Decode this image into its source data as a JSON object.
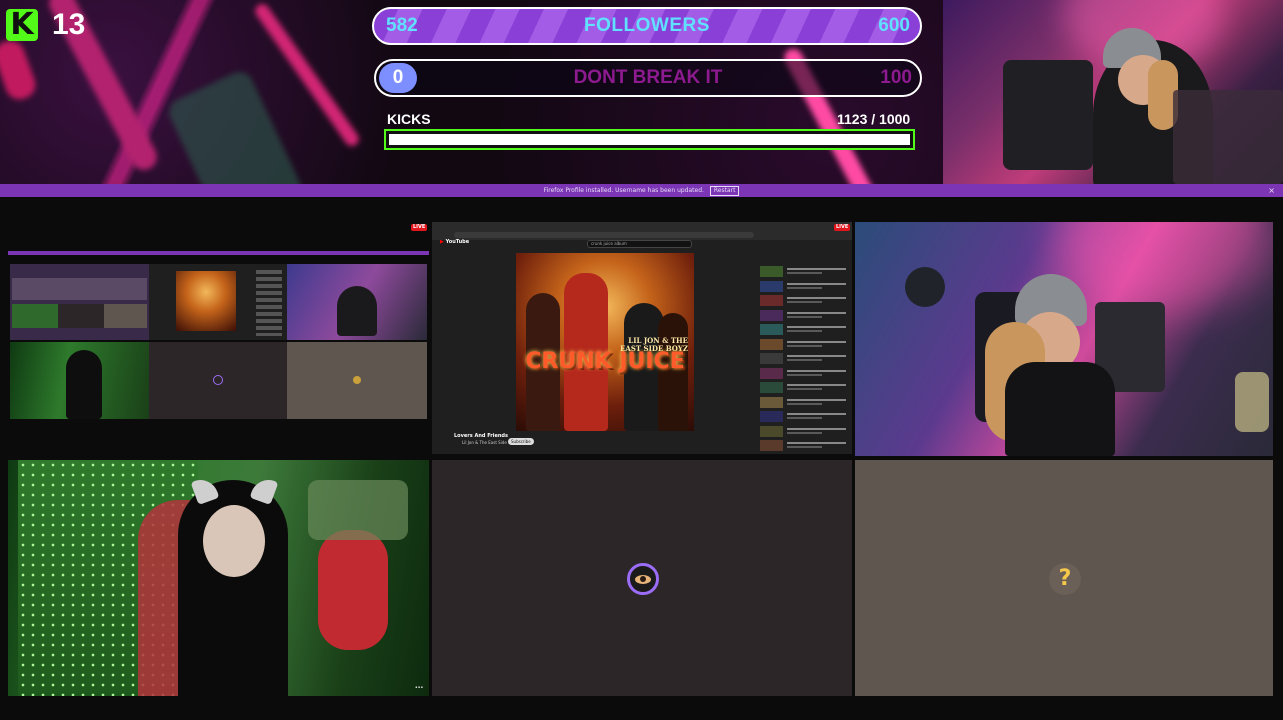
{
  "overlay": {
    "viewer_count": "13",
    "logo_letter": "K",
    "followers": {
      "current": "582",
      "label": "FOLLOWERS",
      "goal": "600"
    },
    "dont_break": {
      "current": "0",
      "label": "DONT BREAK IT",
      "goal": "100"
    },
    "kicks": {
      "label": "KICKS",
      "count": "1123 / 1000",
      "progress": 1.0
    }
  },
  "notification": {
    "text": "Firefox Profile installed. Username has been updated.",
    "button_label": "Restart",
    "close_label": "×"
  },
  "grid": {
    "live_badge": "LIVE",
    "youtube": {
      "logo": "YouTube",
      "search_text": "crunk juice album",
      "album_artist": "LIL JON & THE EAST SIDE BOYZ",
      "album_title": "CRUNK JUICE",
      "video_title": "Lovers And Friends",
      "channel": "Lil Jon & The East Side Boyz",
      "subscribe": "Subscribe",
      "sidebar_count": 14
    },
    "more_label": "⋯"
  },
  "colors": {
    "kick_green": "#53fc18",
    "follower_bar": "#8a3fd6",
    "follower_text": "#5fe1ff",
    "goal_text": "#8d1a8f",
    "notify_bar": "#7b35b5"
  },
  "icons": [
    "kick-logo-icon",
    "eye-avatar-icon",
    "emoji-avatar-icon",
    "youtube-logo-icon",
    "close-icon",
    "more-icon"
  ]
}
